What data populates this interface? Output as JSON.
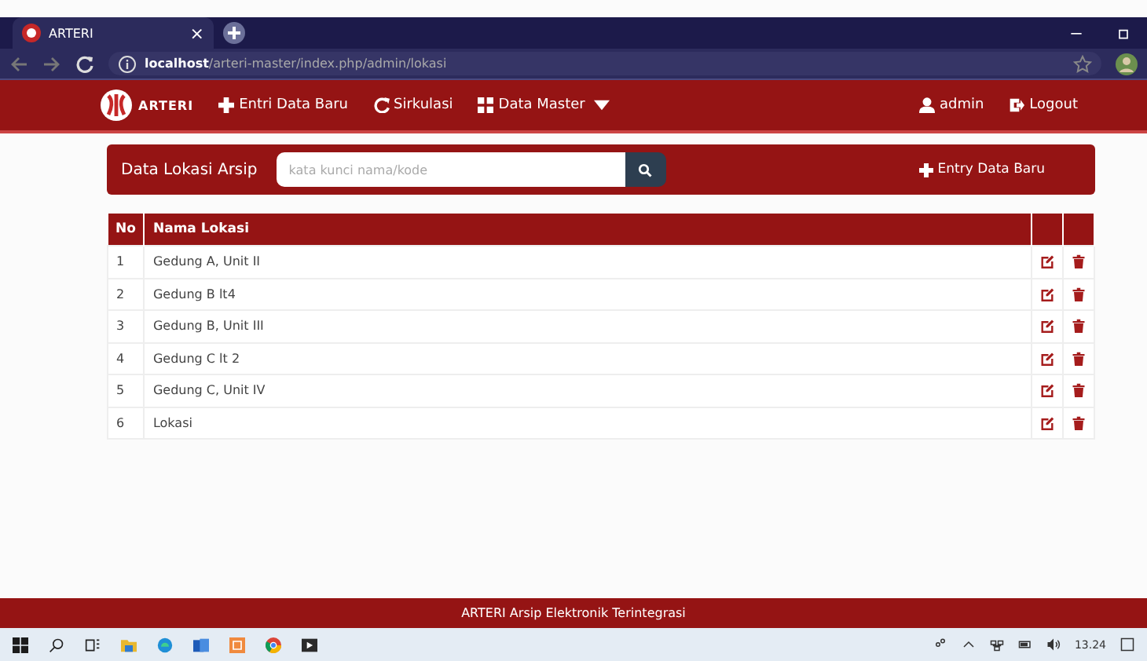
{
  "browser": {
    "tab_title": "ARTERI",
    "tab_close": "×",
    "address_host": "localhost",
    "address_path": "/arteri-master/index.php/admin/lokasi"
  },
  "navbar": {
    "logo_text": "ARTERI",
    "items": [
      {
        "kind": "plus",
        "label": "Entri Data Baru"
      },
      {
        "kind": "sync",
        "label": "Sirkulasi"
      },
      {
        "kind": "grid",
        "label": "Data Master",
        "dropdown": true
      }
    ],
    "right_items": [
      {
        "kind": "user",
        "label": "admin"
      },
      {
        "kind": "logout",
        "label": "Logout"
      }
    ]
  },
  "panel": {
    "title": "Data Lokasi Arsip",
    "search": {
      "placeholder": "kata kunci nama/kode"
    },
    "add_button": "Entry Data Baru"
  },
  "table": {
    "columns": [
      "No",
      "Nama Lokasi"
    ],
    "rows": [
      {
        "no": "1",
        "name": "Gedung A, Unit II"
      },
      {
        "no": "2",
        "name": "Gedung B lt4"
      },
      {
        "no": "3",
        "name": "Gedung B, Unit III"
      },
      {
        "no": "4",
        "name": "Gedung C lt 2"
      },
      {
        "no": "5",
        "name": "Gedung C, Unit IV"
      },
      {
        "no": "6",
        "name": "Lokasi"
      }
    ]
  },
  "footer": {
    "text": "ARTERI Arsip Elektronik Terintegrasi"
  },
  "taskbar": {
    "time": "13.24"
  }
}
